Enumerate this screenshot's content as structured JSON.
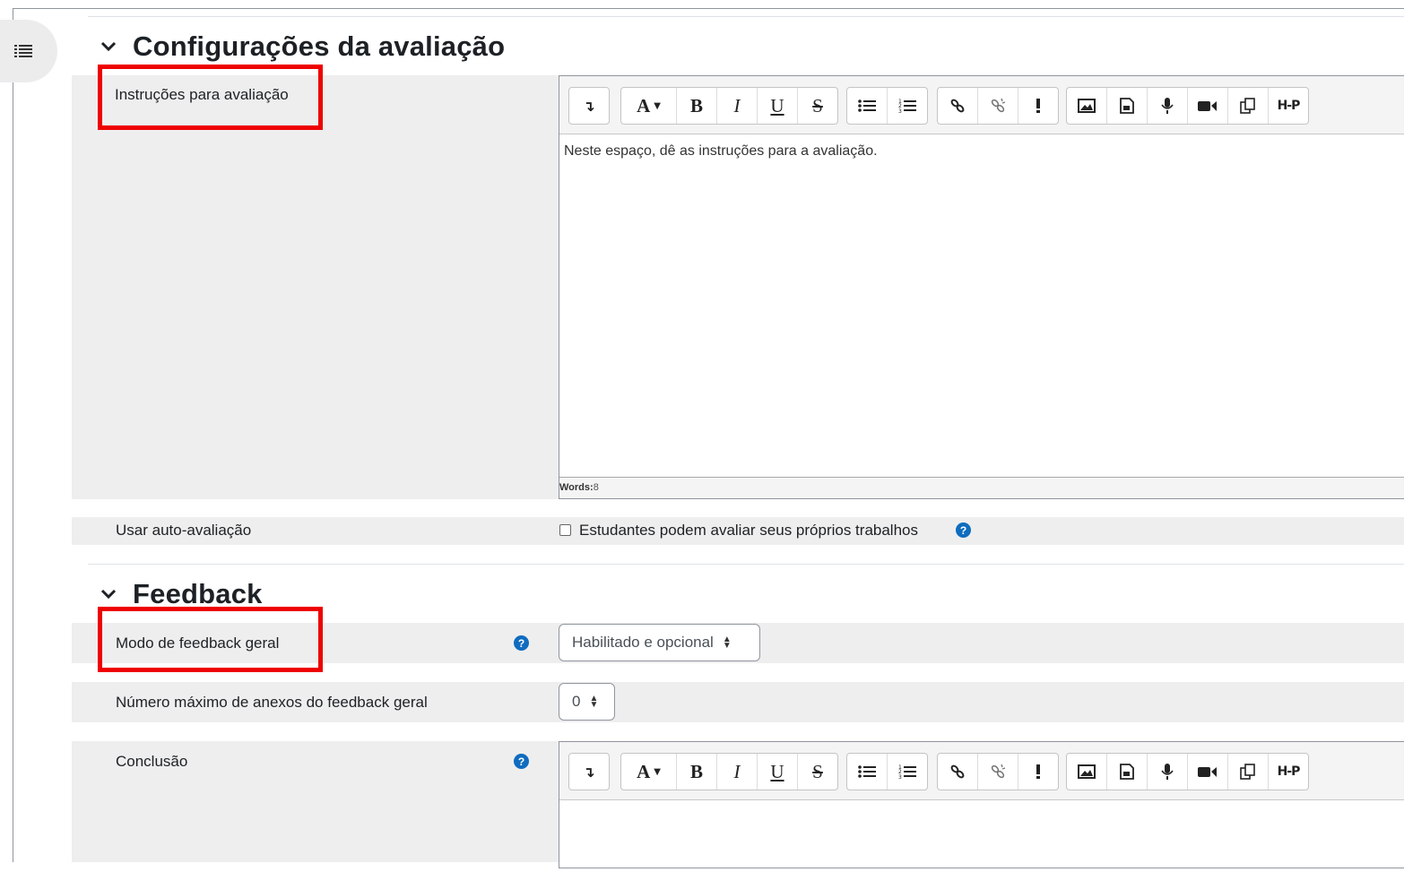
{
  "drawer": {
    "icon": "list-icon"
  },
  "section1": {
    "title": "Configurações da avaliação",
    "instructions": {
      "label": "Instruções para avaliação",
      "editor_text": "Neste espaço, dê as instruções para a avaliação.",
      "words_label": "Words:",
      "words_count": "8"
    },
    "self_assessment": {
      "label": "Usar auto-avaliação",
      "checkbox_label": "Estudantes podem avaliar seus próprios trabalhos",
      "checked": false
    }
  },
  "section2": {
    "title": "Feedback",
    "feedback_mode": {
      "label": "Modo de feedback geral",
      "value": "Habilitado e opcional"
    },
    "max_attachments": {
      "label": "Número máximo de anexos do feedback geral",
      "value": "0"
    },
    "conclusion": {
      "label": "Conclusão"
    }
  },
  "toolbar": {
    "buttons": {
      "collapse": "↴",
      "font": "A",
      "bold": "B",
      "italic": "I",
      "underline": "U",
      "strike": "S",
      "h5p": "H-P"
    },
    "icons": [
      "collapse-icon",
      "font-color-icon",
      "bold-icon",
      "italic-icon",
      "underline-icon",
      "strikethrough-icon",
      "unordered-list-icon",
      "ordered-list-icon",
      "link-icon",
      "unlink-icon",
      "emoji-icon",
      "image-icon",
      "media-icon",
      "record-audio-icon",
      "record-video-icon",
      "manage-files-icon",
      "h5p-icon"
    ]
  },
  "colors": {
    "accent": "#0f6cbf",
    "highlight": "#ee0000",
    "row_bg": "#eeeeee"
  }
}
